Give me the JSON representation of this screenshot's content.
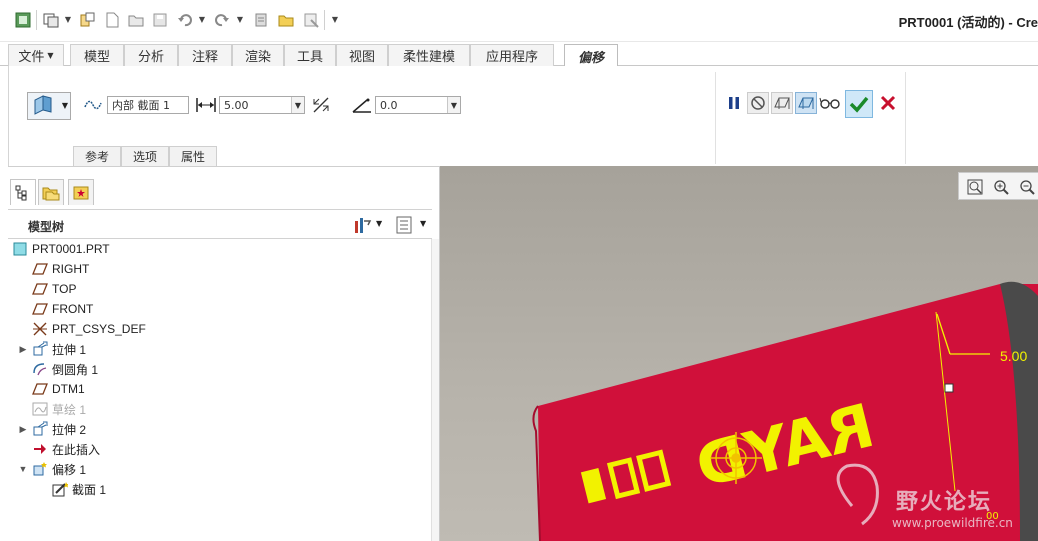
{
  "window": {
    "title": "PRT0001 (活动的) - Cre"
  },
  "quick_access": {
    "icons": [
      "window-icon",
      "regenerate-icon",
      "new-icon",
      "open-icon",
      "save-icon",
      "undo-icon",
      "redo-icon",
      "regen-icon",
      "folder-icon",
      "close-window-icon",
      "customize-icon"
    ]
  },
  "tabs": [
    {
      "label": "文件",
      "has_menu": true
    },
    {
      "label": "模型"
    },
    {
      "label": "分析"
    },
    {
      "label": "注释"
    },
    {
      "label": "渲染"
    },
    {
      "label": "工具"
    },
    {
      "label": "视图"
    },
    {
      "label": "柔性建模"
    },
    {
      "label": "应用程序"
    },
    {
      "label": "偏移",
      "active": true
    }
  ],
  "ribbon": {
    "section_value": "内部 截面 1",
    "distance_value": "5.00",
    "angle_value": "0.0",
    "sub_tabs": [
      "参考",
      "选项",
      "属性"
    ]
  },
  "model_tree": {
    "title": "模型树",
    "items": [
      {
        "label": "PRT0001.PRT",
        "icon": "part-icon",
        "level": 0,
        "expand": ""
      },
      {
        "label": "RIGHT",
        "icon": "datum-plane-icon",
        "level": 1,
        "expand": ""
      },
      {
        "label": "TOP",
        "icon": "datum-plane-icon",
        "level": 1,
        "expand": ""
      },
      {
        "label": "FRONT",
        "icon": "datum-plane-icon",
        "level": 1,
        "expand": ""
      },
      {
        "label": "PRT_CSYS_DEF",
        "icon": "csys-icon",
        "level": 1,
        "expand": ""
      },
      {
        "label": "拉伸 1",
        "icon": "extrude-icon",
        "level": 1,
        "expand": "▶"
      },
      {
        "label": "倒圆角 1",
        "icon": "round-icon",
        "level": 1,
        "expand": ""
      },
      {
        "label": "DTM1",
        "icon": "datum-plane-icon",
        "level": 1,
        "expand": ""
      },
      {
        "label": "草绘 1",
        "icon": "sketch-icon",
        "level": 1,
        "expand": "",
        "dim": true
      },
      {
        "label": "拉伸 2",
        "icon": "extrude-icon",
        "level": 1,
        "expand": "▶"
      },
      {
        "label": "在此插入",
        "icon": "insert-here-icon",
        "level": 1,
        "expand": ""
      },
      {
        "label": "偏移 1",
        "icon": "offset-icon",
        "level": 1,
        "expand": "▼"
      },
      {
        "label": "截面 1",
        "icon": "section-icon",
        "level": 2,
        "expand": ""
      }
    ]
  },
  "viewport": {
    "dimension_label": "5.00",
    "part_text": "RAYD",
    "watermark_text": "野火论坛",
    "watermark_url": "www.proewildfire.cn",
    "small_dim": "00"
  },
  "colors": {
    "part": "#d0103a",
    "dimension": "#f2f200",
    "accent_ok": "#1a8a2a",
    "accent_cancel": "#c8102e"
  }
}
